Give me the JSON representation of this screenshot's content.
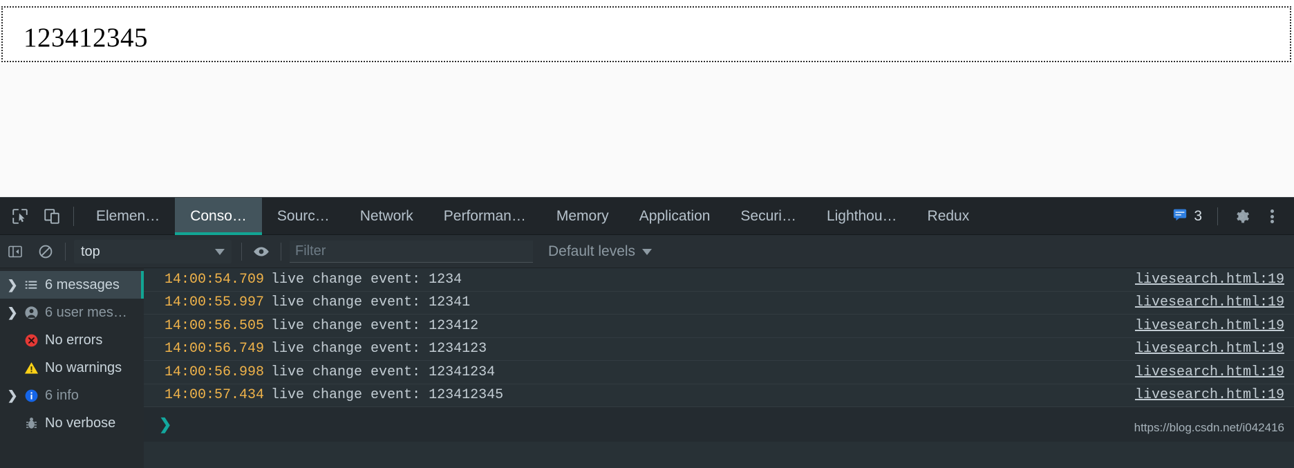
{
  "page": {
    "input_value": "123412345",
    "input_name": "live-search-input"
  },
  "devtools": {
    "tabs": [
      {
        "label": "Elemen…",
        "name": "tab-elements",
        "active": false
      },
      {
        "label": "Conso…",
        "name": "tab-console",
        "active": true
      },
      {
        "label": "Sourc…",
        "name": "tab-sources",
        "active": false
      },
      {
        "label": "Network",
        "name": "tab-network",
        "active": false
      },
      {
        "label": "Performan…",
        "name": "tab-performance",
        "active": false
      },
      {
        "label": "Memory",
        "name": "tab-memory",
        "active": false
      },
      {
        "label": "Application",
        "name": "tab-application",
        "active": false
      },
      {
        "label": "Securi…",
        "name": "tab-security",
        "active": false
      },
      {
        "label": "Lighthou…",
        "name": "tab-lighthouse",
        "active": false
      },
      {
        "label": "Redux",
        "name": "tab-redux",
        "active": false
      }
    ],
    "message_badge_count": "3",
    "accent_color": "#12a594",
    "toolbar": {
      "context_value": "top",
      "filter_placeholder": "Filter",
      "levels_label": "Default levels"
    },
    "sidebar": [
      {
        "label": "6 messages",
        "icon": "list-icon",
        "arrow": true,
        "selected": true,
        "dim": false
      },
      {
        "label": "6 user mes…",
        "icon": "user-icon",
        "arrow": true,
        "selected": false,
        "dim": true
      },
      {
        "label": "No errors",
        "icon": "error-icon",
        "arrow": false,
        "selected": false,
        "dim": false
      },
      {
        "label": "No warnings",
        "icon": "warning-icon",
        "arrow": false,
        "selected": false,
        "dim": false
      },
      {
        "label": "6 info",
        "icon": "info-icon",
        "arrow": true,
        "selected": false,
        "dim": true
      },
      {
        "label": "No verbose",
        "icon": "bug-icon",
        "arrow": false,
        "selected": false,
        "dim": false
      }
    ],
    "logs": [
      {
        "ts": "14:00:54.709",
        "msg": "live change event: 1234",
        "src": "livesearch.html:19"
      },
      {
        "ts": "14:00:55.997",
        "msg": "live change event: 12341",
        "src": "livesearch.html:19"
      },
      {
        "ts": "14:00:56.505",
        "msg": "live change event: 123412",
        "src": "livesearch.html:19"
      },
      {
        "ts": "14:00:56.749",
        "msg": "live change event: 1234123",
        "src": "livesearch.html:19"
      },
      {
        "ts": "14:00:56.998",
        "msg": "live change event: 12341234",
        "src": "livesearch.html:19"
      },
      {
        "ts": "14:00:57.434",
        "msg": "live change event: 123412345",
        "src": "livesearch.html:19"
      }
    ],
    "prompt_caret": "❯",
    "watermark": "https://blog.csdn.net/i042416"
  }
}
